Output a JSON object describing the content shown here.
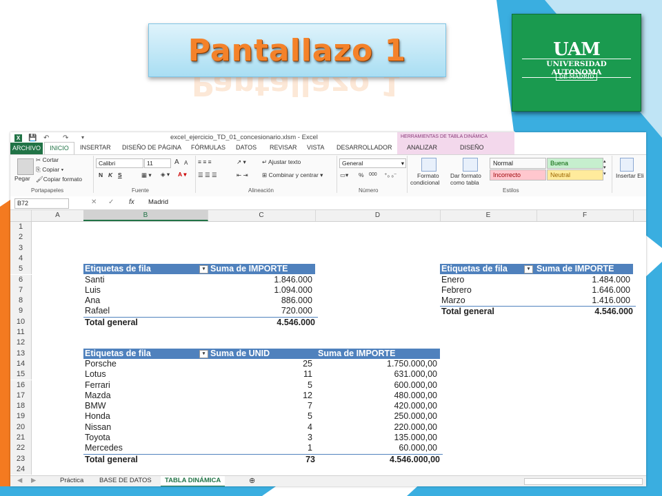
{
  "slide": {
    "title": "Pantallazo 1",
    "logo_mark": "UAM",
    "logo_line1": "UNIVERSIDAD AUTONOMA",
    "logo_line2": "DE MADRID",
    "colors": {
      "blue": "#3aaee0",
      "orange": "#f47a20",
      "title": "#f4822a",
      "logo_green": "#1a9a4f"
    }
  },
  "window": {
    "filename": "excel_ejercicio_TD_01_concesionario.xlsm - Excel",
    "context_title": "HERRAMIENTAS DE TABLA DINÁMICA",
    "quick_access": [
      "save-icon",
      "undo-icon",
      "redo-icon"
    ]
  },
  "menu": {
    "archivo": "ARCHIVO",
    "inicio": "INICIO",
    "tabs": [
      "INSERTAR",
      "DISEÑO DE PÁGINA",
      "FÓRMULAS",
      "DATOS",
      "REVISAR",
      "VISTA",
      "DESARROLLADOR",
      "ANALIZAR",
      "DISEÑO"
    ]
  },
  "ribbon": {
    "pegar": "Pegar",
    "cortar": "Cortar",
    "copiar": "Copiar",
    "copiar_formato": "Copiar formato",
    "portapapeles": "Portapapeles",
    "font_name": "Calibri",
    "font_size": "11",
    "font_grow": "A",
    "font_shrink": "A",
    "bold": "N",
    "italic": "K",
    "underline": "S",
    "font_color": "A",
    "fuente": "Fuente",
    "ajustar_texto": "Ajustar texto",
    "combinar": "Combinar y centrar",
    "alineacion": "Alineación",
    "number_format": "General",
    "percent": "%",
    "thousands": "000",
    "numero": "Número",
    "formato_condicional_1": "Formato",
    "formato_condicional_2": "condicional",
    "dar_formato_1": "Dar formato",
    "dar_formato_2": "como tabla",
    "styles": [
      {
        "label": "Normal",
        "bg": "#ffffff",
        "color": "#000000"
      },
      {
        "label": "Buena",
        "bg": "#c6efce",
        "color": "#006100"
      },
      {
        "label": "Incorrecto",
        "bg": "#ffc7ce",
        "color": "#9c0006"
      },
      {
        "label": "Neutral",
        "bg": "#ffeb9c",
        "color": "#9c6500"
      }
    ],
    "estilos": "Estilos",
    "insertar": "Insertar Eli"
  },
  "formula_bar": {
    "name_box": "B72",
    "fx": "fx",
    "value": "Madrid"
  },
  "columns": [
    "A",
    "B",
    "C",
    "D",
    "E",
    "F"
  ],
  "rows": [
    "1",
    "2",
    "3",
    "4",
    "5",
    "6",
    "7",
    "8",
    "9",
    "10",
    "11",
    "12",
    "13",
    "14",
    "15",
    "16",
    "17",
    "18",
    "19",
    "20",
    "21",
    "22",
    "23",
    "24"
  ],
  "pivot1": {
    "header_label": "Etiquetas de fila",
    "header_value": "Suma de IMPORTE",
    "items": [
      {
        "label": "Santi",
        "value": "1.846.000"
      },
      {
        "label": "Luis",
        "value": "1.094.000"
      },
      {
        "label": "Ana",
        "value": "886.000"
      },
      {
        "label": "Rafael",
        "value": "720.000"
      }
    ],
    "total_label": "Total general",
    "total_value": "4.546.000"
  },
  "pivot2": {
    "header_label": "Etiquetas de fila",
    "header_value": "Suma de IMPORTE",
    "items": [
      {
        "label": "Enero",
        "value": "1.484.000"
      },
      {
        "label": "Febrero",
        "value": "1.646.000"
      },
      {
        "label": "Marzo",
        "value": "1.416.000"
      }
    ],
    "total_label": "Total general",
    "total_value": "4.546.000"
  },
  "pivot3": {
    "header_label": "Etiquetas de fila",
    "header_units": "Suma de UNID",
    "header_value": "Suma de IMPORTE",
    "items": [
      {
        "label": "Porsche",
        "units": "25",
        "value": "1.750.000,00"
      },
      {
        "label": "Lotus",
        "units": "11",
        "value": "631.000,00"
      },
      {
        "label": "Ferrari",
        "units": "5",
        "value": "600.000,00"
      },
      {
        "label": "Mazda",
        "units": "12",
        "value": "480.000,00"
      },
      {
        "label": "BMW",
        "units": "7",
        "value": "420.000,00"
      },
      {
        "label": "Honda",
        "units": "5",
        "value": "250.000,00"
      },
      {
        "label": "Nissan",
        "units": "4",
        "value": "220.000,00"
      },
      {
        "label": "Toyota",
        "units": "3",
        "value": "135.000,00"
      },
      {
        "label": "Mercedes",
        "units": "1",
        "value": "60.000,00"
      }
    ],
    "total_label": "Total general",
    "total_units": "73",
    "total_value": "4.546.000,00"
  },
  "sheet_tabs": [
    "Práctica",
    "BASE DE DATOS",
    "TABLA DINÁMICA"
  ]
}
